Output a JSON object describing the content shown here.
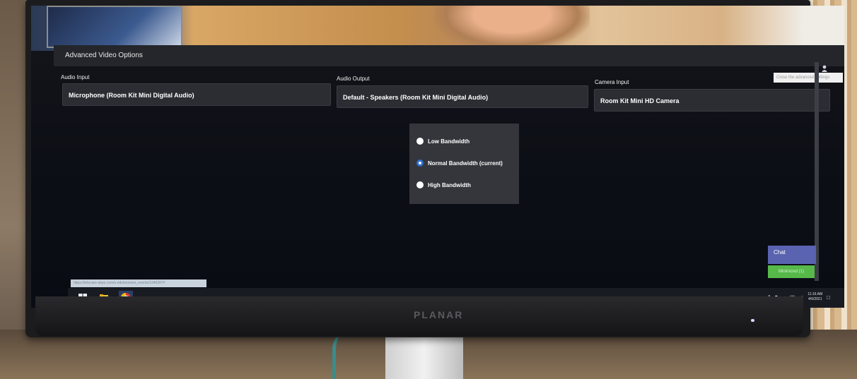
{
  "monitor": {
    "brand": "PLANAR"
  },
  "window": {
    "title": "Advanced Video Options"
  },
  "devices": {
    "audio_input": {
      "label": "Audio Input",
      "value": "Microphone (Room Kit Mini Digital Audio)"
    },
    "audio_output": {
      "label": "Audio Output",
      "value": "Default - Speakers (Room Kit Mini Digital Audio)"
    },
    "camera_input": {
      "label": "Camera Input",
      "value": "Room Kit Mini HD Camera"
    }
  },
  "tooltip": "Close the advanced settings",
  "bandwidth": {
    "options": [
      {
        "label": "Low Bandwidth",
        "selected": false
      },
      {
        "label": "Normal Bandwidth (current)",
        "selected": true
      },
      {
        "label": "High Bandwidth",
        "selected": false
      }
    ]
  },
  "chat": {
    "label": "Chat",
    "minimized_label": "Minimized (1)"
  },
  "status_url": "https://telecare-ahpx.com/u.edu/session_events/1946287#",
  "taskbar": {
    "clock_time": "11:16 AM",
    "clock_date": "4/6/2021"
  },
  "colors": {
    "accent_blue": "#2f6fd0",
    "chat_purple": "#5a63b0",
    "minimized_green": "#56b94a"
  }
}
